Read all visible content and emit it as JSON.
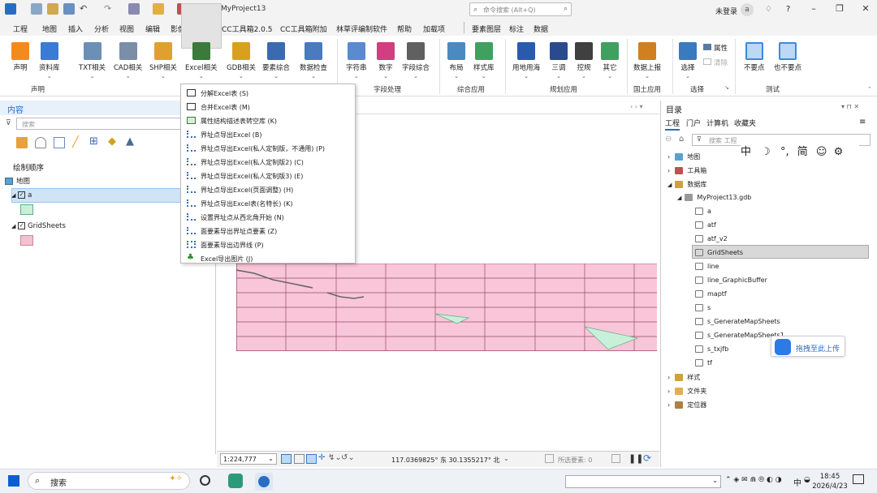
{
  "window": {
    "project_name": "MyProject13",
    "search_placeholder": "命令搜索 (Alt+Q)",
    "login_status": "未登录",
    "avatar_letter": "a",
    "help": "?"
  },
  "menubar": [
    "工程",
    "地图",
    "插入",
    "分析",
    "视图",
    "编辑",
    "影像",
    "共享",
    "CC工具箱2.0.5",
    "CC工具箱附加",
    "林草评编制软件",
    "帮助",
    "加载项",
    "要素图层",
    "标注",
    "数据"
  ],
  "ribbon": {
    "buttons": [
      {
        "label": "声明",
        "color": "#f28b1d"
      },
      {
        "label": "资料库",
        "color": "#3a7bd5"
      },
      {
        "label": "TXT相关",
        "color": "#6b8fb5"
      },
      {
        "label": "CAD相关",
        "color": "#7a8ea8"
      },
      {
        "label": "SHP相关",
        "color": "#e0a030"
      },
      {
        "label": "Excel相关",
        "color": "#3b7a3b"
      },
      {
        "label": "GDB相关",
        "color": "#d9a020"
      },
      {
        "label": "要素综合",
        "color": "#3a6ab0"
      },
      {
        "label": "数据检查",
        "color": "#4a7ac0"
      },
      {
        "label": "字符串",
        "color": "#5a8ad0"
      },
      {
        "label": "数字",
        "color": "#d04080"
      },
      {
        "label": "字段综合",
        "color": "#606060"
      },
      {
        "label": "布局",
        "color": "#4a8ac0"
      },
      {
        "label": "样式库",
        "color": "#40a060"
      },
      {
        "label": "用地用海",
        "color": "#2a5ab0"
      },
      {
        "label": "三调",
        "color": "#2a4a90"
      },
      {
        "label": "控规",
        "color": "#404040"
      },
      {
        "label": "其它",
        "color": "#40a060"
      },
      {
        "label": "数据上报",
        "color": "#d08020"
      },
      {
        "label": "选择",
        "color": "#3a7ac0"
      },
      {
        "label": "不要点",
        "color": "#3a8ae0"
      },
      {
        "label": "也不要点",
        "color": "#3a8ae0"
      }
    ],
    "small_buttons": [
      "属性",
      "清除"
    ],
    "groups": [
      "声明",
      "字段处理",
      "综合应用",
      "规划应用",
      "国土应用",
      "选择",
      "测试"
    ]
  },
  "excel_dropdown": [
    {
      "label": "分解Excel表 (S)",
      "icon": "table-icon"
    },
    {
      "label": "合并Excel表 (M)",
      "icon": "table-icon"
    },
    {
      "label": "属性结构描述表转空库 (K)",
      "icon": "table-icon"
    },
    {
      "label": "界址点导出Excel (B)",
      "icon": "points-icon"
    },
    {
      "label": "界址点导出Excel(私人定制版，不通用) (P)",
      "icon": "points-icon"
    },
    {
      "label": "界址点导出Excel(私人定制版2) (C)",
      "icon": "points-icon"
    },
    {
      "label": "界址点导出Excel(私人定制版3) (E)",
      "icon": "points-icon"
    },
    {
      "label": "界址点导出Excel(页面调整) (H)",
      "icon": "points-icon"
    },
    {
      "label": "界址点导出Excel表(名特长) (K)",
      "icon": "points-icon"
    },
    {
      "label": "设置界址点从西北角开始 (N)",
      "icon": "points-icon"
    },
    {
      "label": "面要素导出界址点要素 (Z)",
      "icon": "points-icon"
    },
    {
      "label": "面要素导出边界线 (P)",
      "icon": "boundary-icon"
    },
    {
      "label": "Excel导出图片 (J)",
      "icon": "leaf-icon"
    }
  ],
  "contents": {
    "title": "内容",
    "search_placeholder": "搜索",
    "drawing_order": "绘制顺序",
    "map": "地图",
    "layers": [
      {
        "name": "a",
        "fill": "#c8f0d8"
      },
      {
        "name": "GridSheets",
        "fill": "#f7bfd3"
      }
    ]
  },
  "status": {
    "scale": "1:224,777",
    "coordinates": "117.0369825° 东 30.1355217° 北",
    "selected": "所选要素: 0"
  },
  "catalog": {
    "title": "目录",
    "tabs": [
      "工程",
      "门户",
      "计算机",
      "收藏夹"
    ],
    "search_placeholder": "搜索 工程",
    "ime_bar": [
      "中",
      "☽",
      "°,",
      "简",
      "☺",
      "⚙"
    ],
    "folders": [
      "地图",
      "工具箱",
      "数据库"
    ],
    "gdb": "MyProject13.gdb",
    "items": [
      "a",
      "atf",
      "atf_v2",
      "GridSheets",
      "line",
      "line_GraphicBuffer",
      "maptf",
      "s",
      "s_GenerateMapSheets",
      "s_GenerateMapSheets1",
      "s_txjfb",
      "tf"
    ],
    "more": [
      "样式",
      "文件夹",
      "定位器"
    ],
    "upload": "拖拽至此上传"
  },
  "taskbar": {
    "search": "搜索",
    "ime": "中",
    "time": "18:45",
    "date": "2026/4/23"
  }
}
